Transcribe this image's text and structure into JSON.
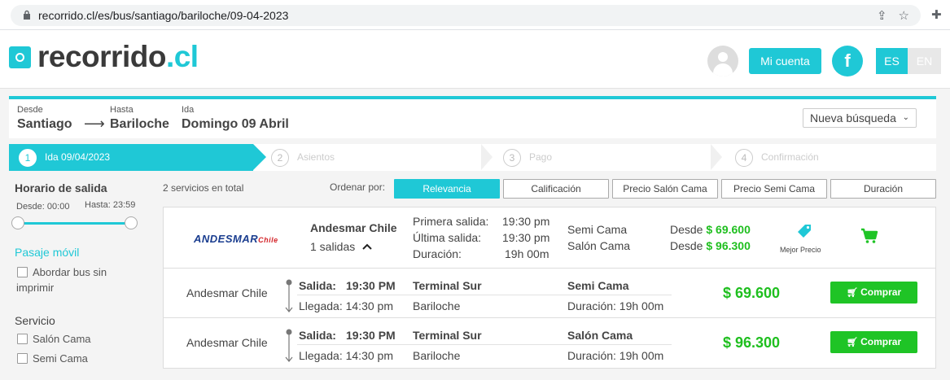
{
  "browser": {
    "url": "recorrido.cl/es/bus/santiago/bariloche/09-04-2023"
  },
  "header": {
    "logo_main": "recorrido",
    "logo_tld": ".cl",
    "account_label": "Mi cuenta",
    "facebook_label": "f",
    "lang_es": "ES",
    "lang_en": "EN"
  },
  "search": {
    "from_label": "Desde",
    "from_value": "Santiago",
    "to_label": "Hasta",
    "to_value": "Bariloche",
    "date_label": "Ida",
    "date_value": "Domingo 09 Abril",
    "new_search_label": "Nueva búsqueda"
  },
  "steps": [
    {
      "num": "1",
      "label": "Ida 09/04/2023",
      "active": true
    },
    {
      "num": "2",
      "label": "Asientos",
      "active": false
    },
    {
      "num": "3",
      "label": "Pago",
      "active": false
    },
    {
      "num": "4",
      "label": "Confirmación",
      "active": false
    }
  ],
  "sidebar": {
    "departure_title": "Horario de salida",
    "from_time": "Desde: 00:00",
    "to_time": "Hasta: 23:59",
    "mobile_ticket_title": "Pasaje móvil",
    "mobile_option_line1": "Abordar bus sin",
    "mobile_option_line2": "imprimir",
    "service_title": "Servicio",
    "service_options": [
      "Salón Cama",
      "Semi Cama"
    ]
  },
  "results": {
    "total_text": "2 servicios en total",
    "order_label": "Ordenar por:",
    "sort_options": [
      "Relevancia",
      "Calificación",
      "Precio Salón Cama",
      "Precio Semi Cama",
      "Duración"
    ],
    "company": {
      "logo_text": "ANDESMAR",
      "logo_suffix": "Chile",
      "name": "Andesmar Chile",
      "departures": "1 salidas",
      "first_label": "Primera salida:",
      "first_value": "19:30 pm",
      "last_label": "Última salida:",
      "last_value": "19:30 pm",
      "duration_label": "Duración:",
      "duration_value": "19h 00m",
      "class1": "Semi Cama",
      "class2": "Salón Cama",
      "from_prefix": "Desde",
      "price1": "$ 69.600",
      "price2": "$ 96.300",
      "best_price_label": "Mejor Precio"
    },
    "trips": [
      {
        "company": "Andesmar Chile",
        "depart_label": "Salida:",
        "depart_time": "19:30 PM",
        "arrive_text": "Llegada: 14:30 pm",
        "origin": "Terminal Sur",
        "destination": "Bariloche",
        "class": "Semi Cama",
        "duration": "Duración: 19h 00m",
        "price": "$ 69.600",
        "buy_label": "Comprar"
      },
      {
        "company": "Andesmar Chile",
        "depart_label": "Salida:",
        "depart_time": "19:30 PM",
        "arrive_text": "Llegada: 14:30 pm",
        "origin": "Terminal Sur",
        "destination": "Bariloche",
        "class": "Salón Cama",
        "duration": "Duración: 19h 00m",
        "price": "$ 96.300",
        "buy_label": "Comprar"
      }
    ]
  },
  "colors": {
    "brand": "#1fc8d6",
    "price_green": "#1fbf1f",
    "buy_green": "#1fc426"
  }
}
